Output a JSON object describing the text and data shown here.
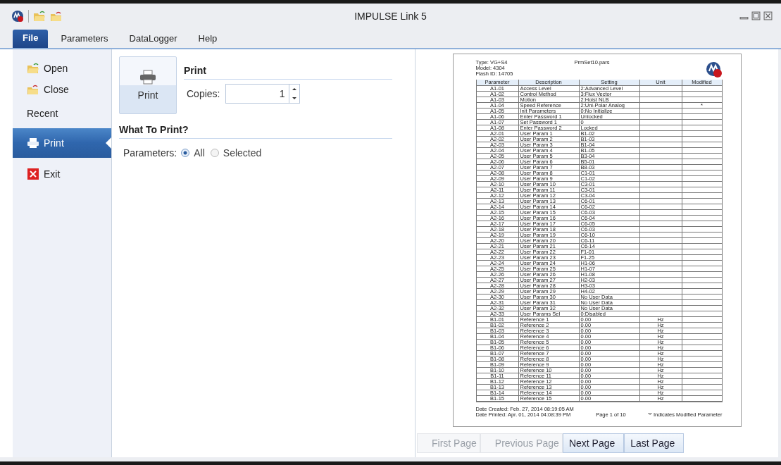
{
  "window": {
    "title": "IMPULSE Link 5"
  },
  "menu": [
    {
      "label": "File",
      "selected": true
    },
    {
      "label": "Parameters",
      "selected": false
    },
    {
      "label": "DataLogger",
      "selected": false
    },
    {
      "label": "Help",
      "selected": false
    }
  ],
  "sidebar": {
    "items": [
      {
        "label": "Open",
        "kind": "open",
        "selected": false
      },
      {
        "label": "Close",
        "kind": "close",
        "selected": false
      },
      {
        "label": "Recent",
        "kind": "recent",
        "selected": false
      },
      {
        "label": "Print",
        "kind": "print",
        "selected": true
      },
      {
        "label": "Exit",
        "kind": "exit",
        "selected": false
      }
    ]
  },
  "print_panel": {
    "button_label": "Print",
    "heading": "Print",
    "copies_label": "Copies:",
    "copies_value": "1",
    "section_heading": "What To Print?",
    "parameters_label": "Parameters:",
    "options": [
      {
        "label": "All",
        "selected": true
      },
      {
        "label": "Selected",
        "selected": false
      }
    ]
  },
  "preview": {
    "info_lines": [
      "Type: VG+S4",
      "Model: 4304",
      "Flash ID: 14705"
    ],
    "file_name": "PrmSet10.pars",
    "columns": [
      "Parameter",
      "Description",
      "Setting",
      "Unit",
      "Modified"
    ],
    "rows": [
      {
        "parameter": "A1-01",
        "description": "Access Level",
        "setting": "2:Advanced Level"
      },
      {
        "parameter": "A1-02",
        "description": "Control Method",
        "setting": "3:Flux Vector"
      },
      {
        "parameter": "A1-03",
        "description": "Motion",
        "setting": "2:Hoist NLB"
      },
      {
        "parameter": "A1-04",
        "description": "Speed Reference",
        "setting": "2:Uni-Polar Analog",
        "modified": "*"
      },
      {
        "parameter": "A1-05",
        "description": "Init Parameters",
        "setting": "0:No Initialize"
      },
      {
        "parameter": "A1-06",
        "description": "Enter Password 1",
        "setting": "Unlocked"
      },
      {
        "parameter": "A1-07",
        "description": "Set Password 1",
        "setting": "0"
      },
      {
        "parameter": "A1-08",
        "description": "Enter Password 2",
        "setting": "Locked"
      },
      {
        "parameter": "A2-01",
        "description": "User Param 1",
        "setting": "B1-02"
      },
      {
        "parameter": "A2-02",
        "description": "User Param 2",
        "setting": "B1-03"
      },
      {
        "parameter": "A2-03",
        "description": "User Param 3",
        "setting": "B1-04"
      },
      {
        "parameter": "A2-04",
        "description": "User Param 4",
        "setting": "B1-05"
      },
      {
        "parameter": "A2-05",
        "description": "User Param 5",
        "setting": "B3-04"
      },
      {
        "parameter": "A2-06",
        "description": "User Param 6",
        "setting": "B5-01"
      },
      {
        "parameter": "A2-07",
        "description": "User Param 7",
        "setting": "B8-03"
      },
      {
        "parameter": "A2-08",
        "description": "User Param 8",
        "setting": "C1-01"
      },
      {
        "parameter": "A2-09",
        "description": "User Param 9",
        "setting": "C1-02"
      },
      {
        "parameter": "A2-10",
        "description": "User Param 10",
        "setting": "C3-01"
      },
      {
        "parameter": "A2-11",
        "description": "User Param 11",
        "setting": "C3-01"
      },
      {
        "parameter": "A2-12",
        "description": "User Param 12",
        "setting": "C3-04"
      },
      {
        "parameter": "A2-13",
        "description": "User Param 13",
        "setting": "C6-01"
      },
      {
        "parameter": "A2-14",
        "description": "User Param 14",
        "setting": "C6-02"
      },
      {
        "parameter": "A2-15",
        "description": "User Param 15",
        "setting": "C6-03"
      },
      {
        "parameter": "A2-16",
        "description": "User Param 16",
        "setting": "C6-04"
      },
      {
        "parameter": "A2-17",
        "description": "User Param 17",
        "setting": "C6-05"
      },
      {
        "parameter": "A2-18",
        "description": "User Param 18",
        "setting": "C6-03"
      },
      {
        "parameter": "A2-19",
        "description": "User Param 19",
        "setting": "C6-10"
      },
      {
        "parameter": "A2-20",
        "description": "User Param 20",
        "setting": "C6-11"
      },
      {
        "parameter": "A2-21",
        "description": "User Param 21",
        "setting": "C6-14"
      },
      {
        "parameter": "A2-22",
        "description": "User Param 22",
        "setting": "F1-01"
      },
      {
        "parameter": "A2-23",
        "description": "User Param 23",
        "setting": "F1-25"
      },
      {
        "parameter": "A2-24",
        "description": "User Param 24",
        "setting": "H1-06"
      },
      {
        "parameter": "A2-25",
        "description": "User Param 25",
        "setting": "H1-07"
      },
      {
        "parameter": "A2-26",
        "description": "User Param 26",
        "setting": "H1-08"
      },
      {
        "parameter": "A2-27",
        "description": "User Param 27",
        "setting": "H2-03"
      },
      {
        "parameter": "A2-28",
        "description": "User Param 28",
        "setting": "H3-03"
      },
      {
        "parameter": "A2-29",
        "description": "User Param 29",
        "setting": "H4-02"
      },
      {
        "parameter": "A2-30",
        "description": "User Param 30",
        "setting": "No User Data"
      },
      {
        "parameter": "A2-31",
        "description": "User Param 31",
        "setting": "No User Data"
      },
      {
        "parameter": "A2-32",
        "description": "User Param 32",
        "setting": "No User Data"
      },
      {
        "parameter": "A2-33",
        "description": "User Params Sel",
        "setting": "0:Disabled"
      },
      {
        "parameter": "B1-01",
        "description": "Reference 1",
        "setting": "0.00",
        "unit": "Hz"
      },
      {
        "parameter": "B1-02",
        "description": "Reference 2",
        "setting": "0.00",
        "unit": "Hz"
      },
      {
        "parameter": "B1-03",
        "description": "Reference 3",
        "setting": "0.00",
        "unit": "Hz"
      },
      {
        "parameter": "B1-04",
        "description": "Reference 4",
        "setting": "0.00",
        "unit": "Hz"
      },
      {
        "parameter": "B1-05",
        "description": "Reference 5",
        "setting": "0.00",
        "unit": "Hz"
      },
      {
        "parameter": "B1-06",
        "description": "Reference 6",
        "setting": "0.00",
        "unit": "Hz"
      },
      {
        "parameter": "B1-07",
        "description": "Reference 7",
        "setting": "0.00",
        "unit": "Hz"
      },
      {
        "parameter": "B1-08",
        "description": "Reference 8",
        "setting": "0.00",
        "unit": "Hz"
      },
      {
        "parameter": "B1-09",
        "description": "Reference 9",
        "setting": "0.00",
        "unit": "Hz"
      },
      {
        "parameter": "B1-10",
        "description": "Reference 10",
        "setting": "0.00",
        "unit": "Hz"
      },
      {
        "parameter": "B1-11",
        "description": "Reference 11",
        "setting": "0.00",
        "unit": "Hz"
      },
      {
        "parameter": "B1-12",
        "description": "Reference 12",
        "setting": "0.00",
        "unit": "Hz"
      },
      {
        "parameter": "B1-13",
        "description": "Reference 13",
        "setting": "0.00",
        "unit": "Hz"
      },
      {
        "parameter": "B1-14",
        "description": "Reference 14",
        "setting": "0.00",
        "unit": "Hz"
      },
      {
        "parameter": "B1-15",
        "description": "Reference 15",
        "setting": "0.00",
        "unit": "Hz"
      }
    ],
    "date_created": "Date Created: Feb. 27, 2014  08:19:05 AM",
    "date_printed": "Date Printed: Apr. 01, 2014  04:08:39 PM",
    "page_number": "Page 1 of 10",
    "legend": "'*' Indicates Modified Parameter"
  },
  "nav_buttons": [
    {
      "label": "First Page",
      "disabled": true
    },
    {
      "label": "Previous Page",
      "disabled": true
    },
    {
      "label": "Next Page",
      "disabled": false
    },
    {
      "label": "Last Page",
      "disabled": false
    }
  ]
}
